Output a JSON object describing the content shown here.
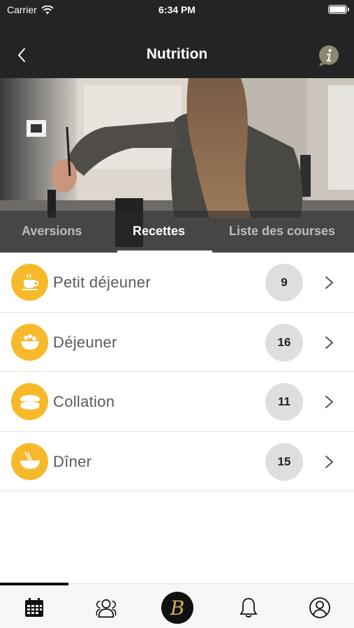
{
  "status_bar": {
    "carrier": "Carrier",
    "time": "6:34 PM"
  },
  "nav": {
    "title": "Nutrition"
  },
  "tabs": [
    {
      "label": "Aversions",
      "active": false
    },
    {
      "label": "Recettes",
      "active": true
    },
    {
      "label": "Liste des courses",
      "active": false
    }
  ],
  "recipes": [
    {
      "label": "Petit déjeuner",
      "count": "9",
      "icon": "coffee-cup-icon"
    },
    {
      "label": "Déjeuner",
      "count": "16",
      "icon": "salad-bowl-icon"
    },
    {
      "label": "Collation",
      "count": "11",
      "icon": "macaron-icon"
    },
    {
      "label": "Dîner",
      "count": "15",
      "icon": "noodle-bowl-icon"
    }
  ],
  "tab_bar": {
    "items": [
      "calendar-icon",
      "community-icon",
      "brand-logo",
      "bell-icon",
      "profile-icon"
    ],
    "logo_letter": "B"
  },
  "colors": {
    "accent": "#f7b92a",
    "header": "#242424",
    "count_badge": "#dedede",
    "logo_gold": "#d4b24a"
  }
}
